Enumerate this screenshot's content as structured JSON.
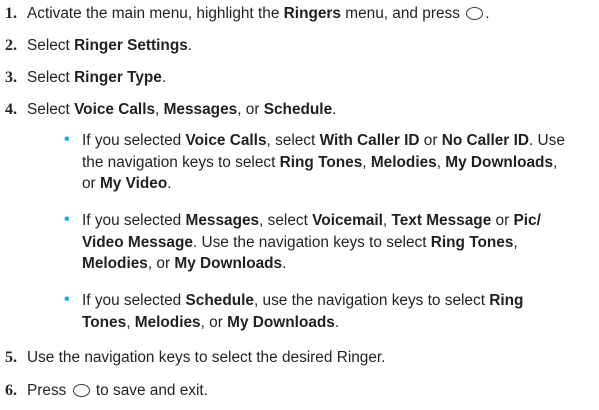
{
  "steps": [
    {
      "number": "1.",
      "parts": [
        "Activate the main menu, highlight the ",
        "Ringers",
        " menu, and press ",
        "."
      ],
      "icon": "ok-key-icon"
    },
    {
      "number": "2.",
      "parts": [
        "Select ",
        "Ringer Settings",
        "."
      ]
    },
    {
      "number": "3.",
      "parts": [
        "Select ",
        "Ringer Type",
        "."
      ]
    },
    {
      "number": "4.",
      "parts": [
        "Select ",
        "Voice Calls",
        ", ",
        "Messages",
        ", or ",
        "Schedule",
        "."
      ]
    },
    {
      "number": "5.",
      "parts": [
        "Use the navigation keys to select the desired Ringer."
      ]
    },
    {
      "number": "6.",
      "parts": [
        "Press ",
        " to save and exit."
      ],
      "icon": "ok-key-icon"
    }
  ],
  "substeps": [
    {
      "lines": [
        [
          "If you selected ",
          "Voice Calls",
          ", select ",
          "With Caller ID",
          " or ",
          "No Caller ID",
          ". Use"
        ],
        [
          "the navigation keys to select ",
          "Ring Tones",
          ", ",
          "Melodies",
          ", ",
          "My Downloads",
          ","
        ],
        [
          "or ",
          "My Video",
          "."
        ]
      ]
    },
    {
      "lines": [
        [
          "If you selected ",
          "Messages",
          ", select ",
          "Voicemail",
          ", ",
          "Text Message",
          " or ",
          "Pic/"
        ],
        [
          "Video Message",
          ". Use the navigation keys to select ",
          "Ring Tones",
          ","
        ],
        [
          "Melodies",
          ", or ",
          "My Downloads",
          "."
        ]
      ]
    },
    {
      "lines": [
        [
          "If you selected ",
          "Schedule",
          ", use the navigation keys to select ",
          "Ring"
        ],
        [
          "Tones",
          ", ",
          "Melodies",
          ", or ",
          "My Downloads",
          "."
        ]
      ]
    }
  ],
  "bullet_glyph": "•",
  "colors": {
    "text": "#231f20",
    "bullet": "#1ea7e1"
  }
}
